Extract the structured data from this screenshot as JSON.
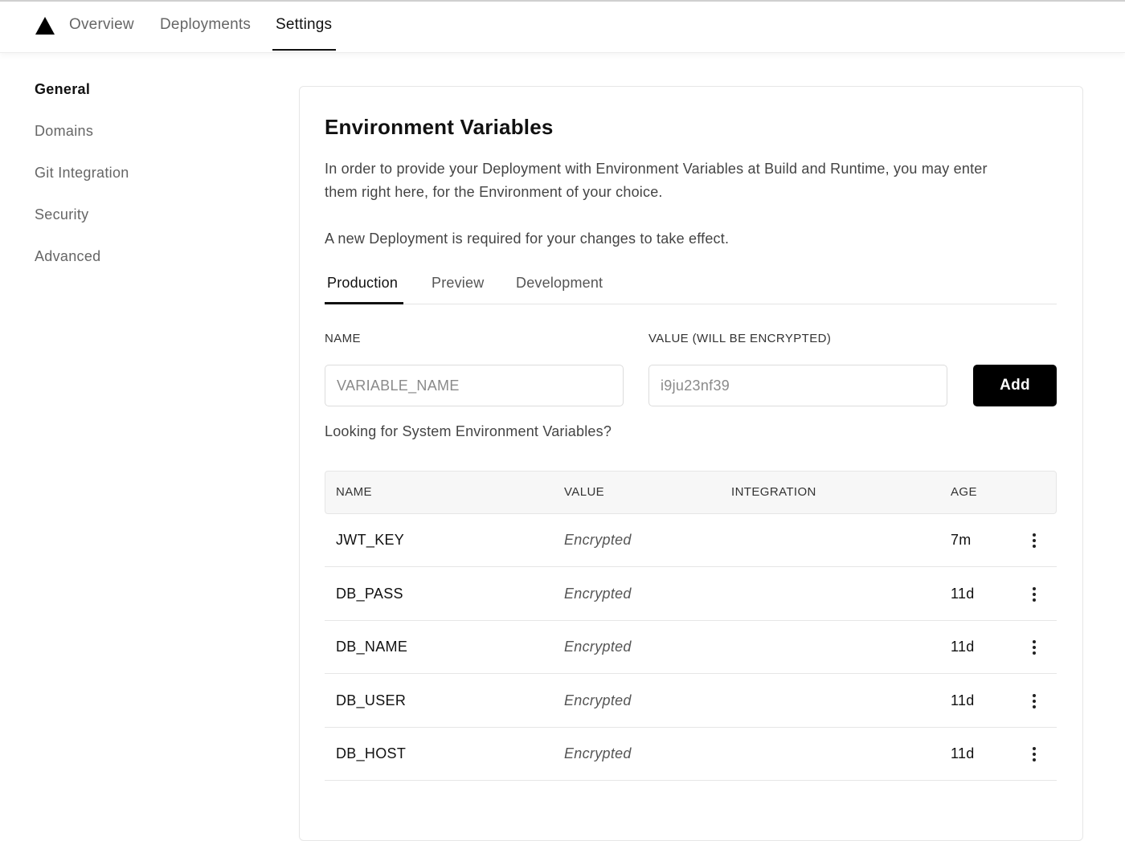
{
  "nav": {
    "logo_icon": "triangle-logo-icon",
    "tabs": [
      {
        "label": "Overview"
      },
      {
        "label": "Deployments"
      },
      {
        "label": "Settings",
        "active": true
      }
    ]
  },
  "sidebar": {
    "items": [
      {
        "label": "General",
        "active": true
      },
      {
        "label": "Domains"
      },
      {
        "label": "Git Integration"
      },
      {
        "label": "Security"
      },
      {
        "label": "Advanced"
      }
    ]
  },
  "env": {
    "title": "Environment Variables",
    "description_line1": "In order to provide your Deployment with Environment Variables at Build and Runtime, you may enter",
    "description_line2": "them right here, for the Environment of your choice.",
    "notice": "A new Deployment is required for your changes to take effect.",
    "tabs": [
      {
        "label": "Production",
        "active": true
      },
      {
        "label": "Preview"
      },
      {
        "label": "Development"
      }
    ],
    "form": {
      "name_label": "NAME",
      "value_label": "VALUE (WILL BE ENCRYPTED)",
      "name_placeholder": "VARIABLE_NAME",
      "value_placeholder": "i9ju23nf39",
      "add_label": "Add"
    },
    "system_link": "Looking for System Environment Variables?",
    "table": {
      "headers": {
        "name": "NAME",
        "value": "VALUE",
        "integration": "INTEGRATION",
        "age": "AGE"
      },
      "rows": [
        {
          "name": "JWT_KEY",
          "value": "Encrypted",
          "integration": "",
          "age": "7m"
        },
        {
          "name": "DB_PASS",
          "value": "Encrypted",
          "integration": "",
          "age": "11d"
        },
        {
          "name": "DB_NAME",
          "value": "Encrypted",
          "integration": "",
          "age": "11d"
        },
        {
          "name": "DB_USER",
          "value": "Encrypted",
          "integration": "",
          "age": "11d"
        },
        {
          "name": "DB_HOST",
          "value": "Encrypted",
          "integration": "",
          "age": "11d"
        }
      ],
      "row_menu_icon": "kebab-menu-icon"
    }
  },
  "colors": {
    "accent": "#000000",
    "text_primary": "#111111",
    "text_secondary": "#666666",
    "border": "#e6e6e6"
  }
}
